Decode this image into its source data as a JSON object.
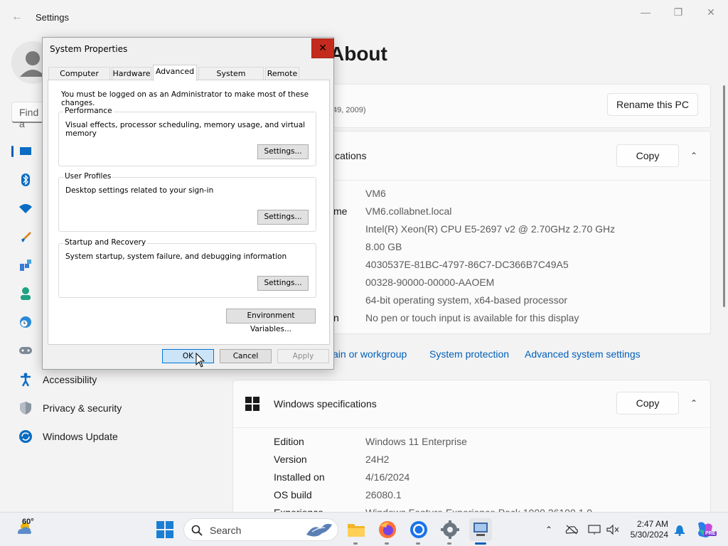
{
  "settings": {
    "app_title": "Settings",
    "find_placeholder": "Find a",
    "page_title": "About",
    "nav": [
      {
        "label": "Accessibility"
      },
      {
        "label": "Privacy & security"
      },
      {
        "label": "Windows Update"
      }
    ],
    "device_card": {
      "subtitle_fragment": "49, 2009)",
      "rename_label": "Rename this PC"
    },
    "device_specs": {
      "header_fragment": "ications",
      "copy_label": "Copy",
      "rows": [
        {
          "label": "",
          "value": "VM6"
        },
        {
          "label": "me",
          "value": "VM6.collabnet.local"
        },
        {
          "label": "",
          "value": "Intel(R) Xeon(R) CPU E5-2697 v2 @ 2.70GHz   2.70 GHz"
        },
        {
          "label": "",
          "value": "8.00 GB"
        },
        {
          "label": "",
          "value": "4030537E-81BC-4797-86C7-DC366B7C49A5"
        },
        {
          "label": "",
          "value": "00328-90000-00000-AAOEM"
        },
        {
          "label": "",
          "value": "64-bit operating system, x64-based processor"
        },
        {
          "label": "n",
          "value": "No pen or touch input is available for this display"
        }
      ]
    },
    "related_links": [
      "ain or workgroup",
      "System protection",
      "Advanced system settings"
    ],
    "windows_specs": {
      "header": "Windows specifications",
      "copy_label": "Copy",
      "rows": [
        {
          "label": "Edition",
          "value": "Windows 11 Enterprise"
        },
        {
          "label": "Version",
          "value": "24H2"
        },
        {
          "label": "Installed on",
          "value": "4/16/2024"
        },
        {
          "label": "OS build",
          "value": "26080.1"
        },
        {
          "label": "Experience",
          "value": "Windows Feature Experience Pack 1000.26100.1.0"
        }
      ]
    }
  },
  "dialog": {
    "title": "System Properties",
    "close_glyph": "✕",
    "tabs": [
      "Computer Name",
      "Hardware",
      "Advanced",
      "System Protection",
      "Remote"
    ],
    "active_tab": "Advanced",
    "admin_note": "You must be logged on as an Administrator to make most of these changes.",
    "groups": [
      {
        "title": "Performance",
        "desc": "Visual effects, processor scheduling, memory usage, and virtual memory",
        "button": "Settings..."
      },
      {
        "title": "User Profiles",
        "desc": "Desktop settings related to your sign-in",
        "button": "Settings..."
      },
      {
        "title": "Startup and Recovery",
        "desc": "System startup, system failure, and debugging information",
        "button": "Settings..."
      }
    ],
    "env_button": "Environment Variables...",
    "ok": "OK",
    "cancel": "Cancel",
    "apply": "Apply"
  },
  "taskbar": {
    "weather_temp": "60°",
    "search_label": "Search",
    "time": "2:47 AM",
    "date": "5/30/2024",
    "copilot_badge": "PRE"
  },
  "colors": {
    "accent": "#005fb8",
    "close_red": "#c42b1c",
    "default_button": "#cce4f7"
  }
}
